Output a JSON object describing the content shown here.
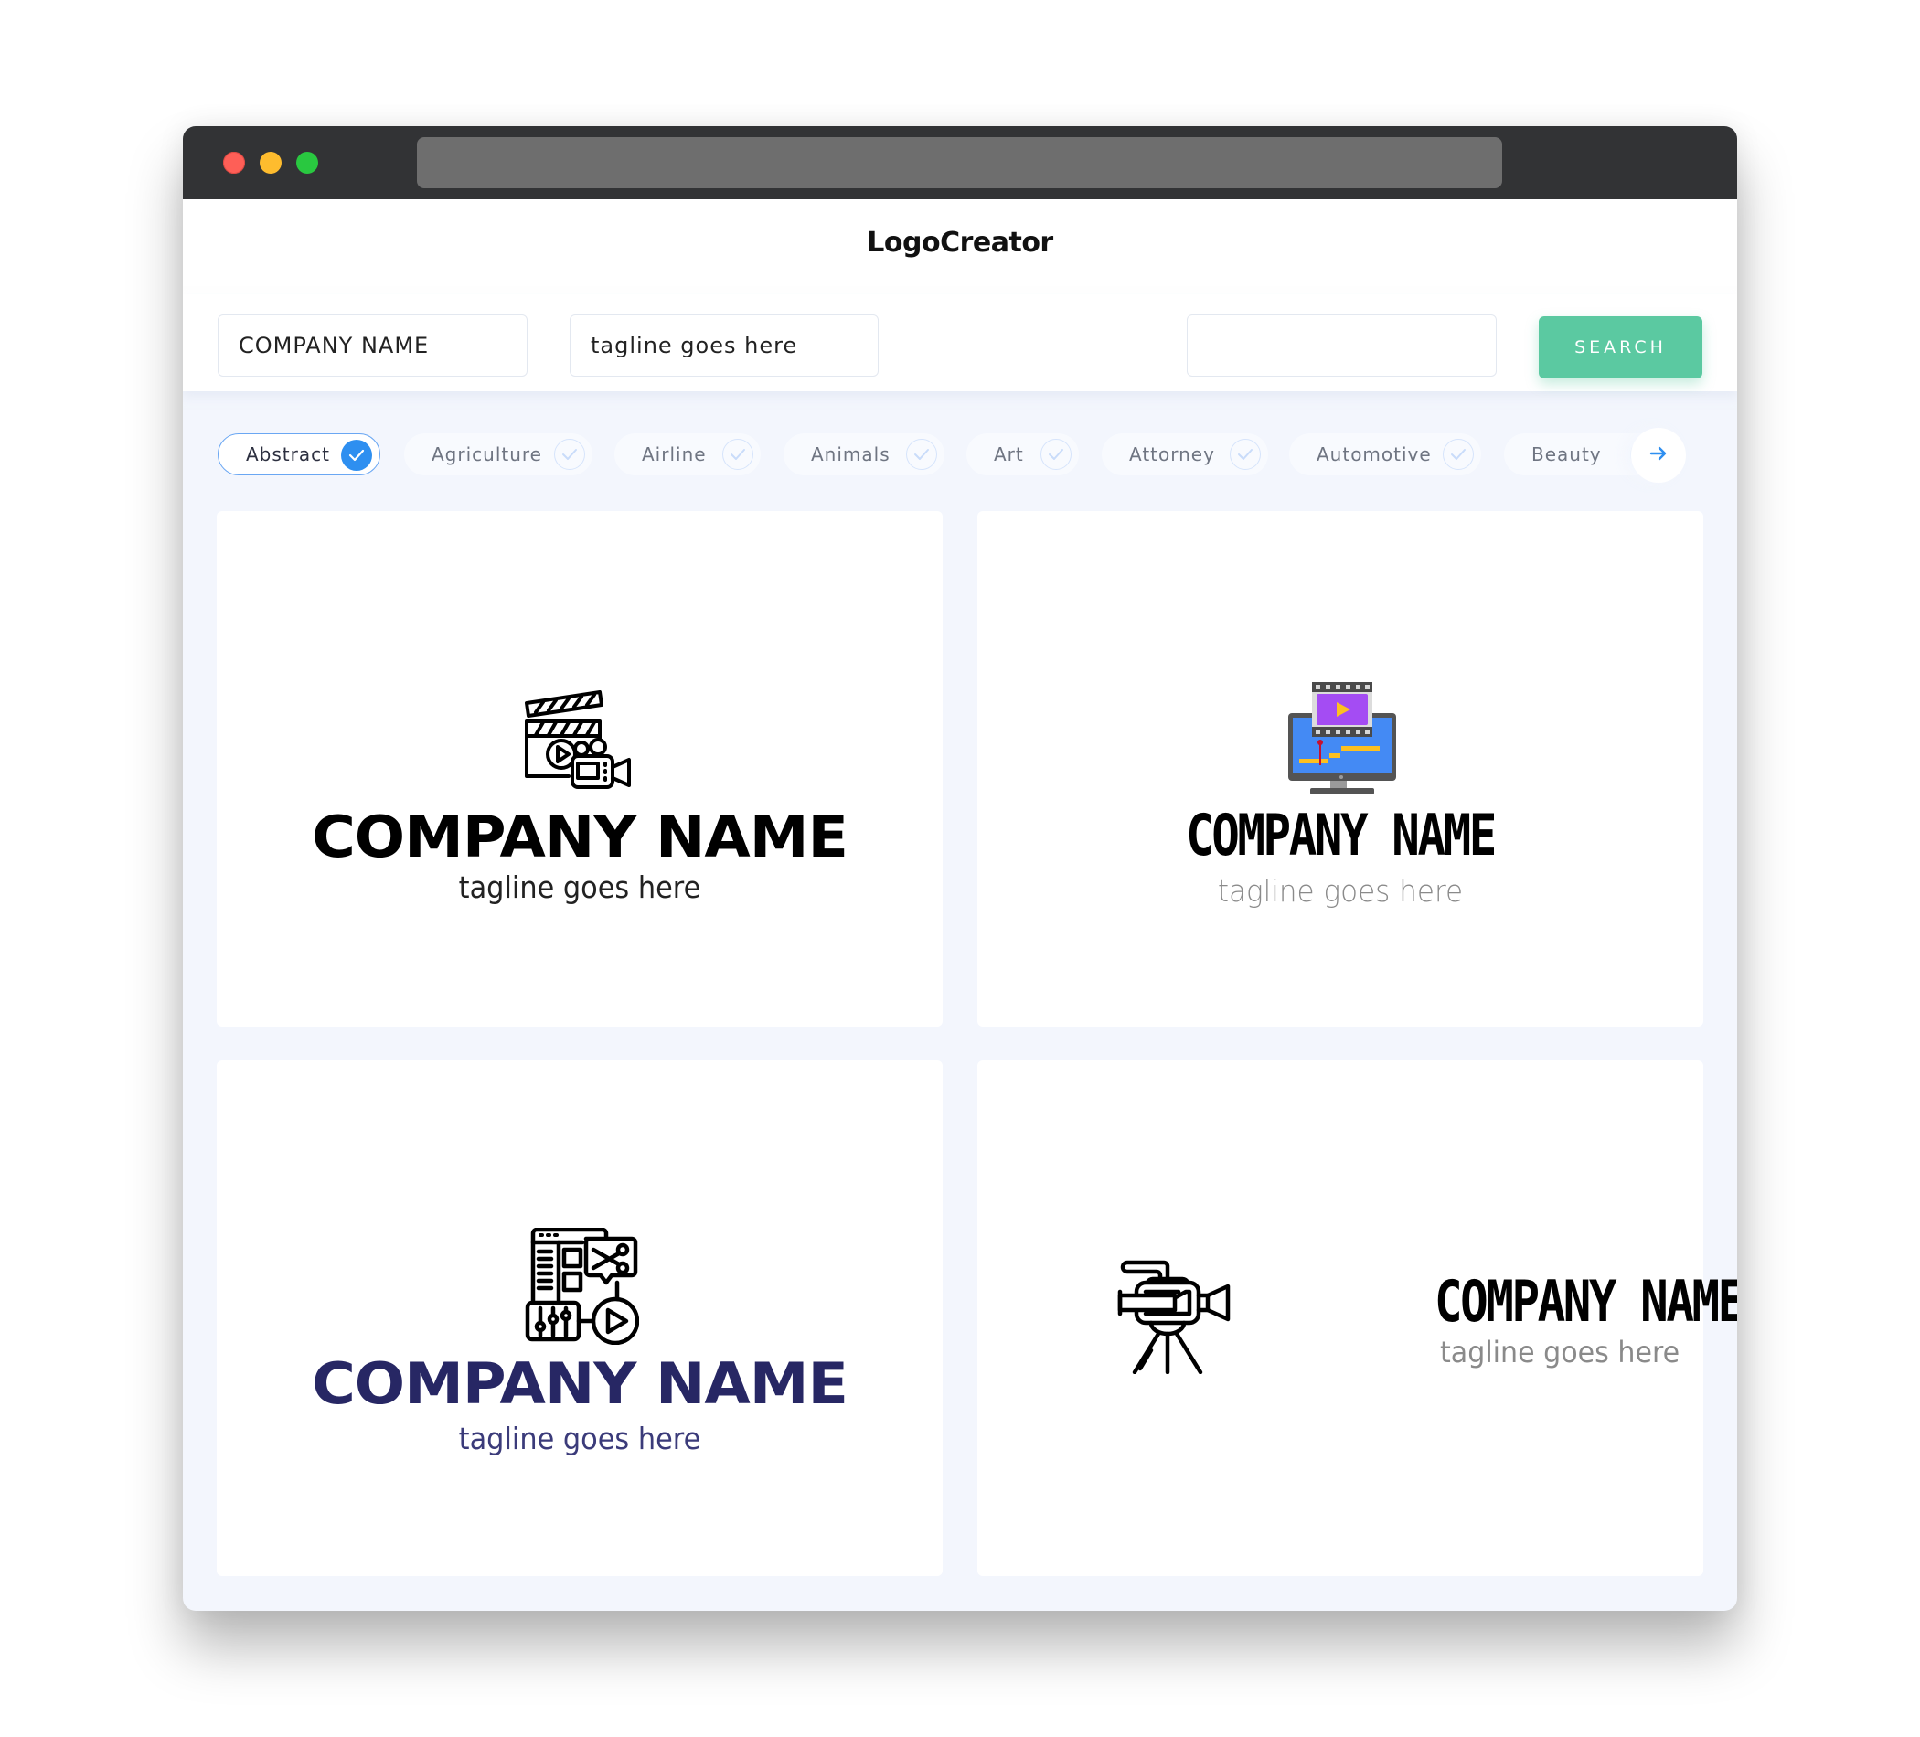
{
  "window": {
    "traffic_lights": [
      "close",
      "minimize",
      "maximize"
    ],
    "url": ""
  },
  "header": {
    "title": "LogoCreator"
  },
  "search": {
    "company_name_value": "COMPANY NAME",
    "tagline_value": "tagline goes here",
    "keyword_value": "",
    "button_label": "SEARCH",
    "button_color": "#5bc9a1"
  },
  "categories": {
    "items": [
      {
        "label": "Abstract",
        "selected": true
      },
      {
        "label": "Agriculture",
        "selected": false
      },
      {
        "label": "Airline",
        "selected": false
      },
      {
        "label": "Animals",
        "selected": false
      },
      {
        "label": "Art",
        "selected": false
      },
      {
        "label": "Attorney",
        "selected": false
      },
      {
        "label": "Automotive",
        "selected": false
      },
      {
        "label": "Beauty",
        "selected": false
      }
    ],
    "next_icon": "arrow-right-icon",
    "accent_color": "#2e8ff0"
  },
  "logos": [
    {
      "icon": "clapperboard-camera-icon",
      "company_name": "COMPANY NAME",
      "tagline": "tagline goes here",
      "name_color": "#000000",
      "layout": "stacked"
    },
    {
      "icon": "monitor-video-editing-icon",
      "company_name": "COMPANY NAME",
      "tagline": "tagline goes here",
      "name_color": "#000000",
      "layout": "stacked"
    },
    {
      "icon": "video-editing-app-icon",
      "company_name": "COMPANY NAME",
      "tagline": "tagline goes here",
      "name_color": "#272764",
      "layout": "stacked"
    },
    {
      "icon": "tripod-video-camera-icon",
      "company_name": "COMPANY NAME",
      "tagline": "tagline goes here",
      "name_color": "#000000",
      "layout": "inline"
    }
  ]
}
